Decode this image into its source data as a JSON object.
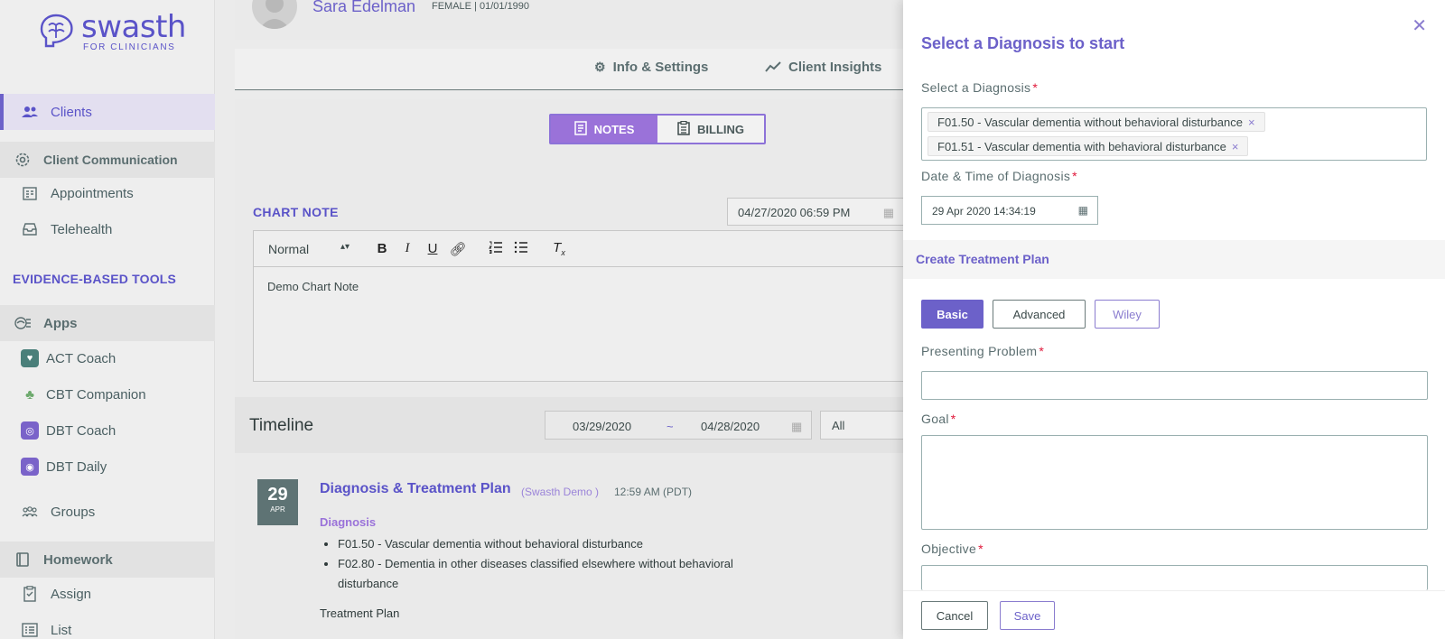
{
  "brand": {
    "name": "swasth",
    "sub": "FOR CLINICIANS",
    "accent": "#5a53c8"
  },
  "sidebar": {
    "clients": "Clients",
    "client_communication": "Client Communication",
    "appointments": "Appointments",
    "telehealth": "Telehealth",
    "evidence_tools": "EVIDENCE-BASED TOOLS",
    "apps": "Apps",
    "app_items": [
      {
        "label": "ACT Coach",
        "icon": "act-coach-icon",
        "color": "#4a7f7a"
      },
      {
        "label": "CBT Companion",
        "icon": "cbt-companion-icon",
        "color": "#6ca96c"
      },
      {
        "label": "DBT Coach",
        "icon": "dbt-coach-icon",
        "color": "#7a63c9"
      },
      {
        "label": "DBT Daily",
        "icon": "dbt-daily-icon",
        "color": "#7a63c9"
      }
    ],
    "groups": "Groups",
    "homework": "Homework",
    "assign": "Assign",
    "list": "List"
  },
  "client": {
    "name": "Sara Edelman",
    "meta": "FEMALE | 01/01/1990"
  },
  "tabs": {
    "info": "Info & Settings",
    "insights": "Client Insights"
  },
  "segment": {
    "notes": "NOTES",
    "billing": "BILLING"
  },
  "chart_note": {
    "label": "CHART NOTE",
    "datetime": "04/27/2020 06:59 PM",
    "format": "Normal",
    "body": "Demo Chart Note"
  },
  "timeline": {
    "title": "Timeline",
    "from": "03/29/2020",
    "sep": "~",
    "to": "04/28/2020",
    "filter": "All"
  },
  "entry": {
    "day": "29",
    "month": "APR",
    "title": "Diagnosis & Treatment Plan",
    "author": "(Swasth Demo )",
    "time": "12:59 AM (PDT)",
    "section": "Diagnosis",
    "items": [
      "F01.50 - Vascular dementia without behavioral disturbance",
      "F02.80 - Dementia in other diseases classified elsewhere without behavioral disturbance"
    ],
    "treatment_plan": "Treatment Plan"
  },
  "panel": {
    "title": "Select a Diagnosis to start",
    "select_label": "Select a Diagnosis",
    "chips": [
      "F01.50 - Vascular dementia without behavioral disturbance",
      "F01.51 - Vascular dementia with behavioral disturbance"
    ],
    "date_label": "Date & Time of Diagnosis",
    "date_value": "29 Apr 2020 14:34:19",
    "create_plan": "Create Treatment Plan",
    "modes": {
      "basic": "Basic",
      "advanced": "Advanced",
      "wiley": "Wiley"
    },
    "presenting_problem": "Presenting Problem",
    "goal": "Goal",
    "objective": "Objective",
    "cancel": "Cancel",
    "save": "Save"
  }
}
